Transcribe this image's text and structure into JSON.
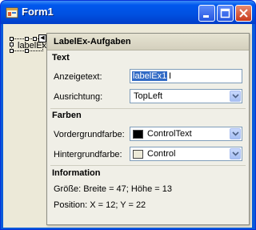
{
  "window": {
    "title": "Form1",
    "accent": "#0054e3"
  },
  "designer": {
    "label_text": "labelEx1"
  },
  "tasks": {
    "title": "LabelEx-Aufgaben",
    "text_section": {
      "heading": "Text",
      "display_text_label": "Anzeigetext:",
      "display_text_value": "labelEx1",
      "alignment_label": "Ausrichtung:",
      "alignment_value": "TopLeft"
    },
    "colors_section": {
      "heading": "Farben",
      "fore_label": "Vordergrundfarbe:",
      "fore_value": "ControlText",
      "fore_color": "#000000",
      "back_label": "Hintergrundfarbe:",
      "back_value": "Control",
      "back_color": "#ece9d8"
    },
    "info_section": {
      "heading": "Information",
      "size_text": "Größe: Breite = 47; Höhe = 13",
      "position_text": "Position: X = 12; Y = 22"
    }
  }
}
